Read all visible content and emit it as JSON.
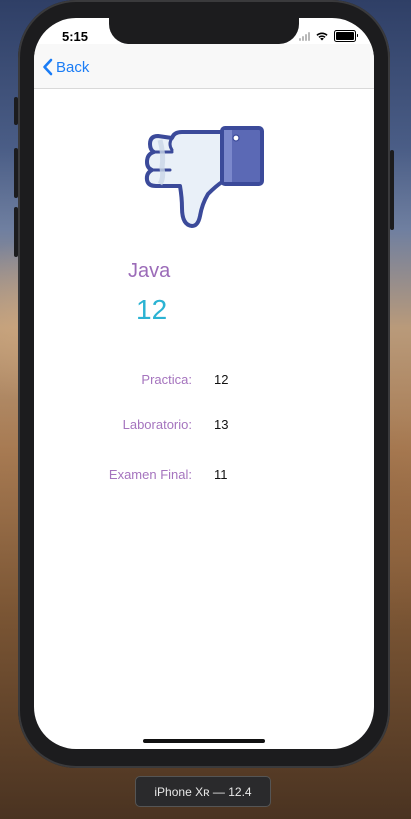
{
  "status_bar": {
    "time": "5:15"
  },
  "navbar": {
    "back_label": "Back"
  },
  "course": {
    "name": "Java",
    "score": "12"
  },
  "grades": [
    {
      "label": "Practica:",
      "value": "12"
    },
    {
      "label": "Laboratorio:",
      "value": "13"
    },
    {
      "label": "Examen Final:",
      "value": "11"
    }
  ],
  "simulator": {
    "device_label": "iPhone Xʀ — 12.4"
  },
  "icons": {
    "result": "thumbs-down-icon",
    "back": "chevron-left-icon"
  },
  "colors": {
    "accent": "#1a7cf5",
    "label_purple": "#a574be",
    "score_cyan": "#2bb3d3"
  }
}
